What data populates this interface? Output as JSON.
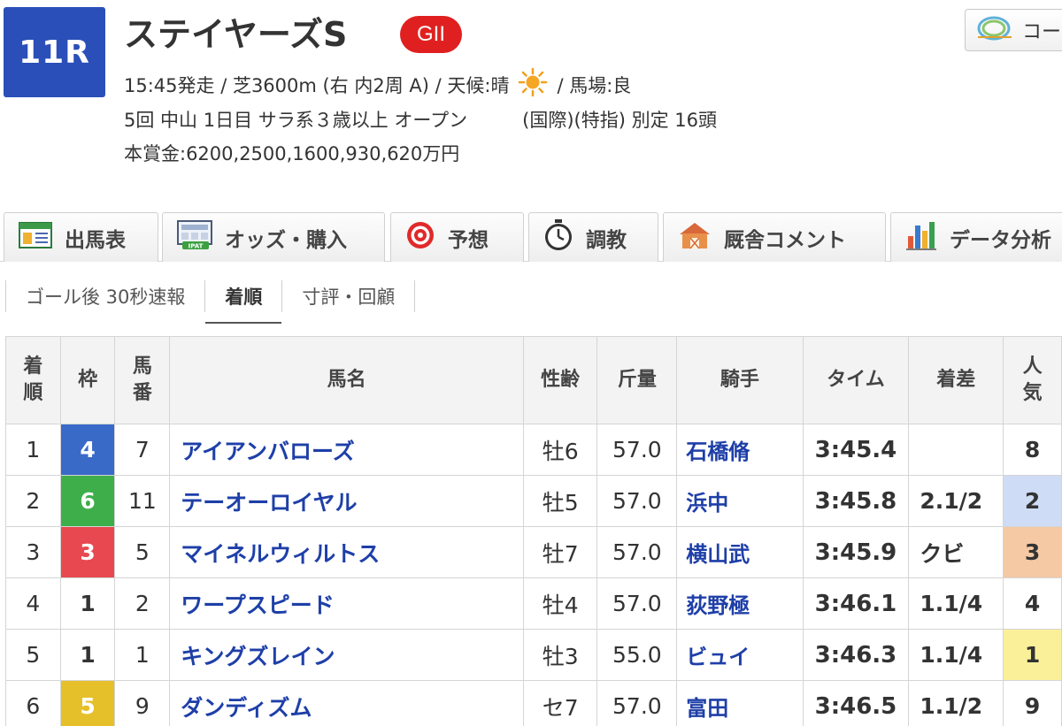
{
  "header": {
    "race_number": "11R",
    "race_name": "ステイヤーズS",
    "grade": "GII",
    "course_button_label": "コー",
    "start_time_course": "15:45発走 / 芝3600m (右 内2周 A) / 天候:晴",
    "track_condition": "/ 馬場:良",
    "meeting_info": "5回 中山 1日目 サラ系３歳以上 オープン",
    "race_conditions": "(国際)(特指) 別定 16頭",
    "prize_money": "本賞金:6200,2500,1600,930,620万円"
  },
  "tabs": [
    {
      "label": "出馬表",
      "icon": "race-card-icon"
    },
    {
      "label": "オッズ・購入",
      "icon": "ipat-icon"
    },
    {
      "label": "予想",
      "icon": "target-icon"
    },
    {
      "label": "調教",
      "icon": "stopwatch-icon"
    },
    {
      "label": "厩舎コメント",
      "icon": "stable-icon"
    },
    {
      "label": "データ分析",
      "icon": "bar-chart-icon"
    }
  ],
  "subtabs": [
    {
      "label": "ゴール後 30秒速報"
    },
    {
      "label": "着順",
      "active": true
    },
    {
      "label": "寸評・回顧"
    }
  ],
  "table": {
    "headers": {
      "rank": [
        "着",
        "順"
      ],
      "waku": "枠",
      "umaban": [
        "馬",
        "番"
      ],
      "horse": "馬名",
      "sex_age": "性齢",
      "weight": "斤量",
      "jockey": "騎手",
      "time": "タイム",
      "margin": "着差",
      "popularity": [
        "人",
        "気"
      ]
    },
    "rows": [
      {
        "rank": "1",
        "waku": "4",
        "umaban": "7",
        "horse": "アイアンバローズ",
        "sex_age": "牡6",
        "weight": "57.0",
        "jockey": "石橋脩",
        "time": "3:45.4",
        "margin": "",
        "popularity": "8"
      },
      {
        "rank": "2",
        "waku": "6",
        "umaban": "11",
        "horse": "テーオーロイヤル",
        "sex_age": "牡5",
        "weight": "57.0",
        "jockey": "浜中",
        "time": "3:45.8",
        "margin": "2.1/2",
        "popularity": "2"
      },
      {
        "rank": "3",
        "waku": "3",
        "umaban": "5",
        "horse": "マイネルウィルトス",
        "sex_age": "牡7",
        "weight": "57.0",
        "jockey": "横山武",
        "time": "3:45.9",
        "margin": "クビ",
        "popularity": "3"
      },
      {
        "rank": "4",
        "waku": "1",
        "umaban": "2",
        "horse": "ワープスピード",
        "sex_age": "牡4",
        "weight": "57.0",
        "jockey": "荻野極",
        "time": "3:46.1",
        "margin": "1.1/4",
        "popularity": "4"
      },
      {
        "rank": "5",
        "waku": "1",
        "umaban": "1",
        "horse": "キングズレイン",
        "sex_age": "牡3",
        "weight": "55.0",
        "jockey": "ビュイ",
        "time": "3:46.3",
        "margin": "1.1/4",
        "popularity": "1"
      },
      {
        "rank": "6",
        "waku": "5",
        "umaban": "9",
        "horse": "ダンディズム",
        "sex_age": "セ7",
        "weight": "57.0",
        "jockey": "富田",
        "time": "3:46.5",
        "margin": "1.1/2",
        "popularity": "9"
      }
    ]
  },
  "colors": {
    "race_badge": "#2a4fb8",
    "grade_badge": "#e02020",
    "link_blue": "#1e3fa8",
    "waku": {
      "1": "#ffffff",
      "3": "#e8484f",
      "4": "#3a6ac8",
      "5": "#e6c02a",
      "6": "#3eae4a"
    },
    "popularity": {
      "1": "#fbf09a",
      "2": "#cfdcf5",
      "3": "#f4c9a4"
    }
  }
}
